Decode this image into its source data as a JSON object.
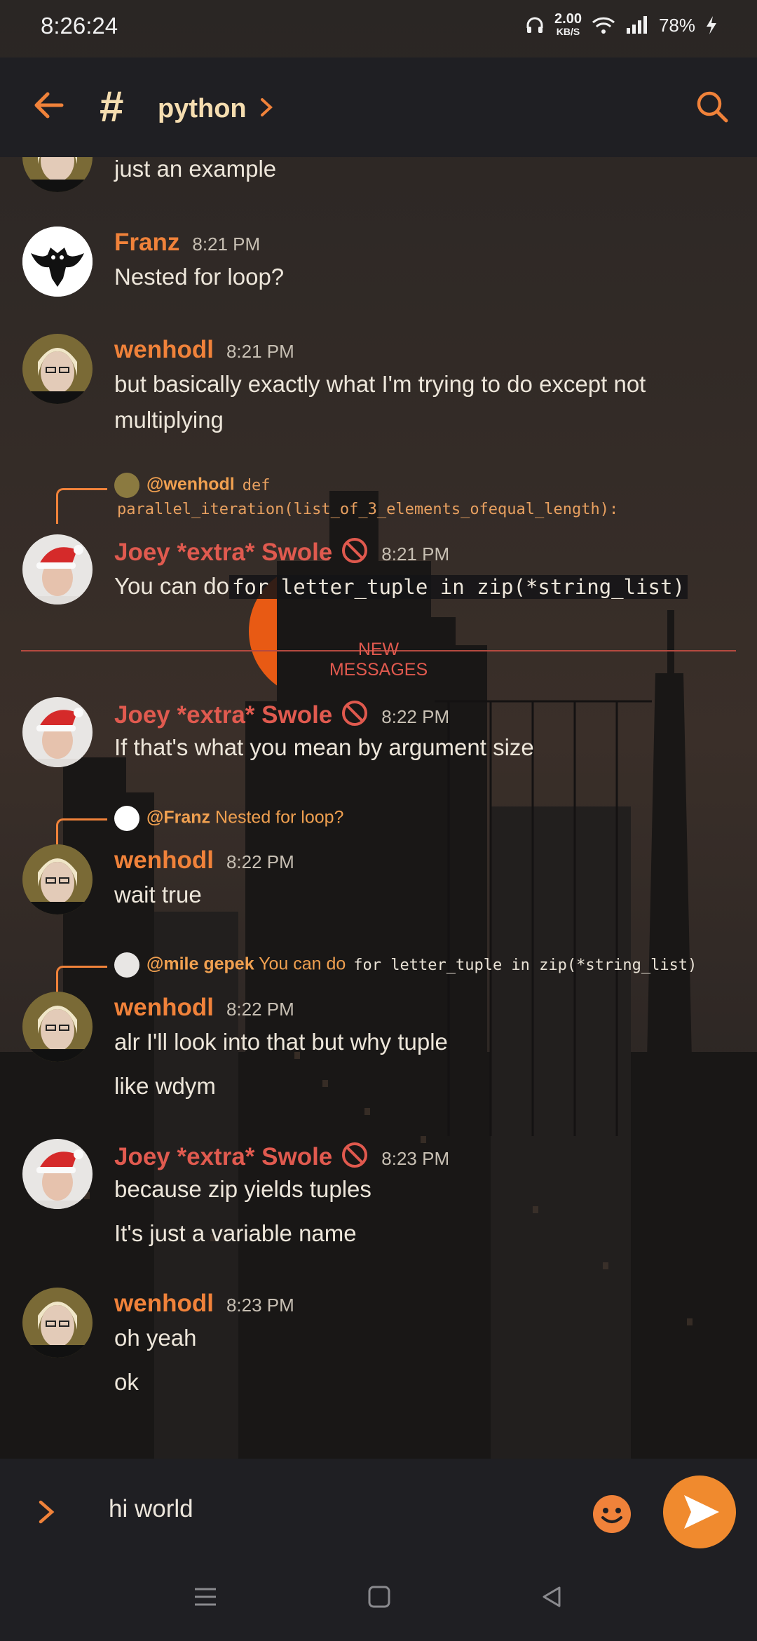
{
  "status_bar": {
    "time": "8:26:24",
    "speed_value": "2.00",
    "speed_unit": "KB/S",
    "battery": "78%"
  },
  "header": {
    "channel": "python"
  },
  "messages": [
    {
      "text": "just an example"
    },
    {
      "author": "Franz",
      "time": "8:21 PM",
      "text": "Nested for loop?"
    },
    {
      "author": "wenhodl",
      "time": "8:21 PM",
      "text1": "but basically exactly what I'm trying to do except not",
      "text2": "multiplying"
    },
    {
      "reply_to": "@wenhodl",
      "reply_prefix": "def",
      "reply_code": "parallel_iteration(list_of_3_elements_ofequal_length):",
      "author": "Joey *extra* Swole",
      "time": "8:21 PM",
      "text": "You can do",
      "code": "for letter_tuple in zip(*string_list)"
    },
    {
      "author": "Joey *extra* Swole",
      "time": "8:22 PM",
      "text": "If that's what you mean by argument size"
    },
    {
      "reply_to": "@Franz",
      "reply_text": "Nested for loop?",
      "author": "wenhodl",
      "time": "8:22 PM",
      "text": "wait true"
    },
    {
      "reply_to": "@mile gepek",
      "reply_text": "You can do",
      "reply_code": "for letter_tuple in zip(*string_list)",
      "author": "wenhodl",
      "time": "8:22 PM",
      "text1": "alr I'll look into that but why tuple",
      "text2": "like wdym"
    },
    {
      "author": "Joey *extra* Swole",
      "time": "8:23 PM",
      "text1": "because zip yields tuples",
      "text2": "It's just a variable name"
    },
    {
      "author": "wenhodl",
      "time": "8:23 PM",
      "text1": "oh yeah",
      "text2": "ok"
    }
  ],
  "divider": "NEW MESSAGES",
  "composer": {
    "value": "hi world"
  },
  "colors": {
    "accent": "#f0823a",
    "red_name": "#e05a4f",
    "background": "#1c1b1f"
  }
}
